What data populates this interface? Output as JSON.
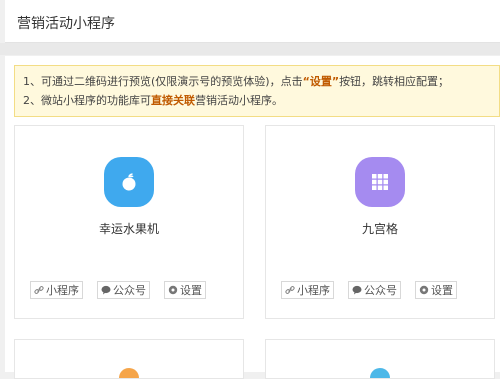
{
  "header": {
    "title": "营销活动小程序"
  },
  "notice": {
    "line1_prefix": "1、可通过二维码进行预览(仅限演示号的预览体验)，点击",
    "line1_bold": "“设置”",
    "line1_suffix": "按钮，跳转相应配置；",
    "line2_prefix": "2、微站小程序的功能库可",
    "line2_bold": "直接关联",
    "line2_suffix": "营销活动小程序。"
  },
  "colors": {
    "lucky_icon": "#3fa9ee",
    "grid_icon": "#a58bf0",
    "notice_bg": "#fff9dd"
  },
  "cards": [
    {
      "name": "幸运水果机",
      "icon": "apple-icon",
      "actions": {
        "miniprogram": "小程序",
        "official": "公众号",
        "settings": "设置"
      }
    },
    {
      "name": "九宫格",
      "icon": "grid-icon",
      "actions": {
        "miniprogram": "小程序",
        "official": "公众号",
        "settings": "设置"
      }
    }
  ]
}
